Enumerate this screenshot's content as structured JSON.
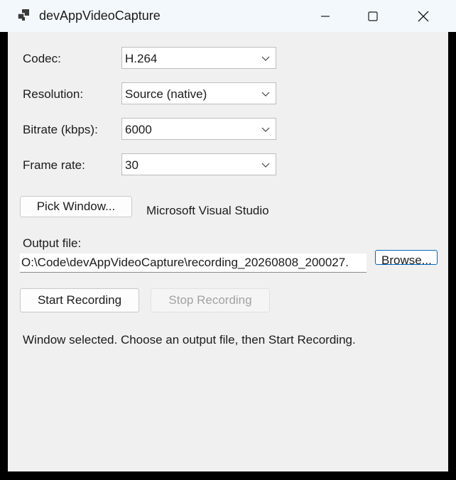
{
  "window": {
    "title": "devAppVideoCapture",
    "icon": "app-window-icon",
    "controls": [
      "minimize-icon",
      "maximize-icon",
      "close-icon"
    ]
  },
  "settings": {
    "codec": {
      "label": "Codec:",
      "value": "H.264"
    },
    "resolution": {
      "label": "Resolution:",
      "value": "Source (native)"
    },
    "bitrate": {
      "label": "Bitrate (kbps):",
      "value": "6000"
    },
    "framerate": {
      "label": "Frame rate:",
      "value": "30"
    }
  },
  "pick": {
    "button_label": "Pick Window...",
    "selected_window": "Microsoft Visual Studio"
  },
  "output": {
    "label": "Output file:",
    "path": "O:\\Code\\devAppVideoCapture\\recording_20260808_200027.",
    "browse_label": "Browse..."
  },
  "recording": {
    "start_label": "Start Recording",
    "stop_label": "Stop Recording"
  },
  "status": {
    "text": "Window selected. Choose an output file, then Start Recording."
  },
  "colors": {
    "titlebar": "#f3f8fd",
    "client": "#f0f0f0",
    "accent_border": "#0067c0",
    "disabled_text": "#a2a2a2"
  }
}
